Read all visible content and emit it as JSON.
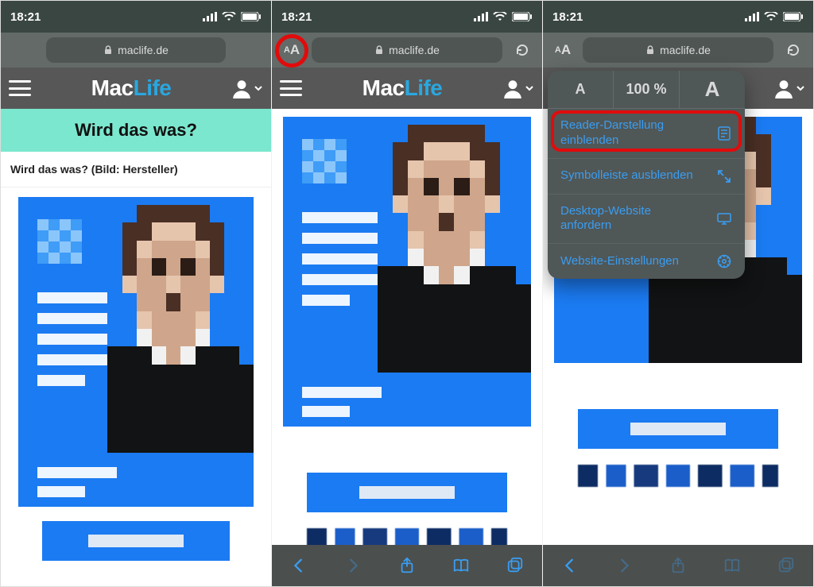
{
  "status": {
    "time": "18:21"
  },
  "url_bar": {
    "domain": "maclife.de",
    "aa_label": "AA"
  },
  "brand": {
    "mac": "Mac",
    "life": "Life"
  },
  "phone1": {
    "headline": "Wird das was?",
    "caption": "Wird das was? (Bild: Hersteller)"
  },
  "popover": {
    "zoom_percent": "100 %",
    "items": [
      {
        "label": "Reader-Darstellung einblenden",
        "icon": "reader"
      },
      {
        "label": "Symbolleiste ausblenden",
        "icon": "expand"
      },
      {
        "label": "Desktop-Website anfordern",
        "icon": "desktop"
      },
      {
        "label": "Website-Einstellungen",
        "icon": "gear"
      }
    ]
  }
}
